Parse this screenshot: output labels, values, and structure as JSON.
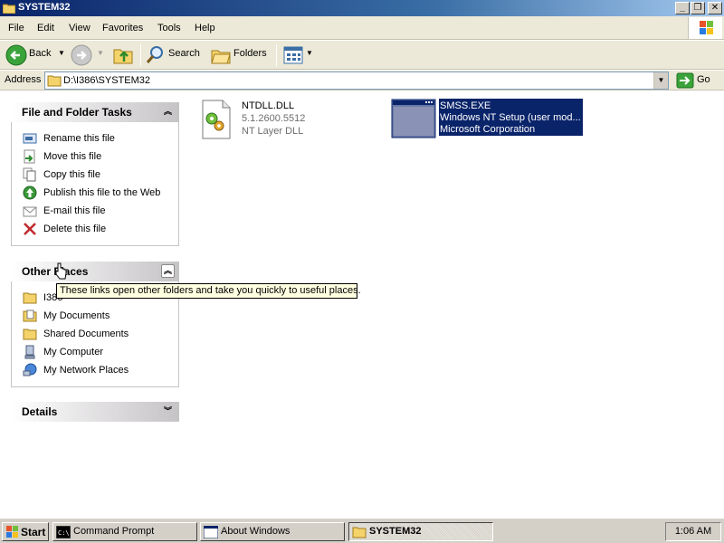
{
  "window": {
    "title": "SYSTEM32",
    "minimize": "_",
    "restore": "❐",
    "close": "✕"
  },
  "menu": {
    "file": "File",
    "edit": "Edit",
    "view": "View",
    "favorites": "Favorites",
    "tools": "Tools",
    "help": "Help"
  },
  "toolbar": {
    "back": "Back",
    "search": "Search",
    "folders": "Folders"
  },
  "address": {
    "label": "Address",
    "value": "D:\\I386\\SYSTEM32",
    "go": "Go"
  },
  "task_pane": {
    "file_tasks": {
      "title": "File and Folder Tasks",
      "items": [
        {
          "label": "Rename this file",
          "icon": "rename-icon"
        },
        {
          "label": "Move this file",
          "icon": "move-icon"
        },
        {
          "label": "Copy this file",
          "icon": "copy-icon"
        },
        {
          "label": "Publish this file to the Web",
          "icon": "publish-web-icon"
        },
        {
          "label": "E-mail this file",
          "icon": "email-icon"
        },
        {
          "label": "Delete this file",
          "icon": "delete-icon"
        }
      ]
    },
    "other_places": {
      "title": "Other Places",
      "items": [
        {
          "label": "I386",
          "icon": "folder-icon"
        },
        {
          "label": "My Documents",
          "icon": "my-documents-icon"
        },
        {
          "label": "Shared Documents",
          "icon": "folder-icon"
        },
        {
          "label": "My Computer",
          "icon": "my-computer-icon"
        },
        {
          "label": "My Network Places",
          "icon": "network-places-icon"
        }
      ]
    },
    "details": {
      "title": "Details"
    }
  },
  "files": [
    {
      "name": "NTDLL.DLL",
      "line2": "5.1.2600.5512",
      "line3": "NT Layer DLL",
      "selected": false
    },
    {
      "name": "SMSS.EXE",
      "line2": "Windows NT Setup (user mod...",
      "line3": "Microsoft Corporation",
      "selected": true
    }
  ],
  "tooltip": "These links open other folders and take you quickly to useful places.",
  "taskbar": {
    "start": "Start",
    "buttons": [
      {
        "label": "Command Prompt",
        "active": false
      },
      {
        "label": "About Windows",
        "active": false
      },
      {
        "label": "SYSTEM32",
        "active": true
      }
    ],
    "clock": "1:06 AM"
  },
  "colors": {
    "title_gradient_start": "#0a246a",
    "selection": "#0a246a",
    "tooltip_bg": "#ffffe1",
    "chrome": "#ece9d8"
  }
}
